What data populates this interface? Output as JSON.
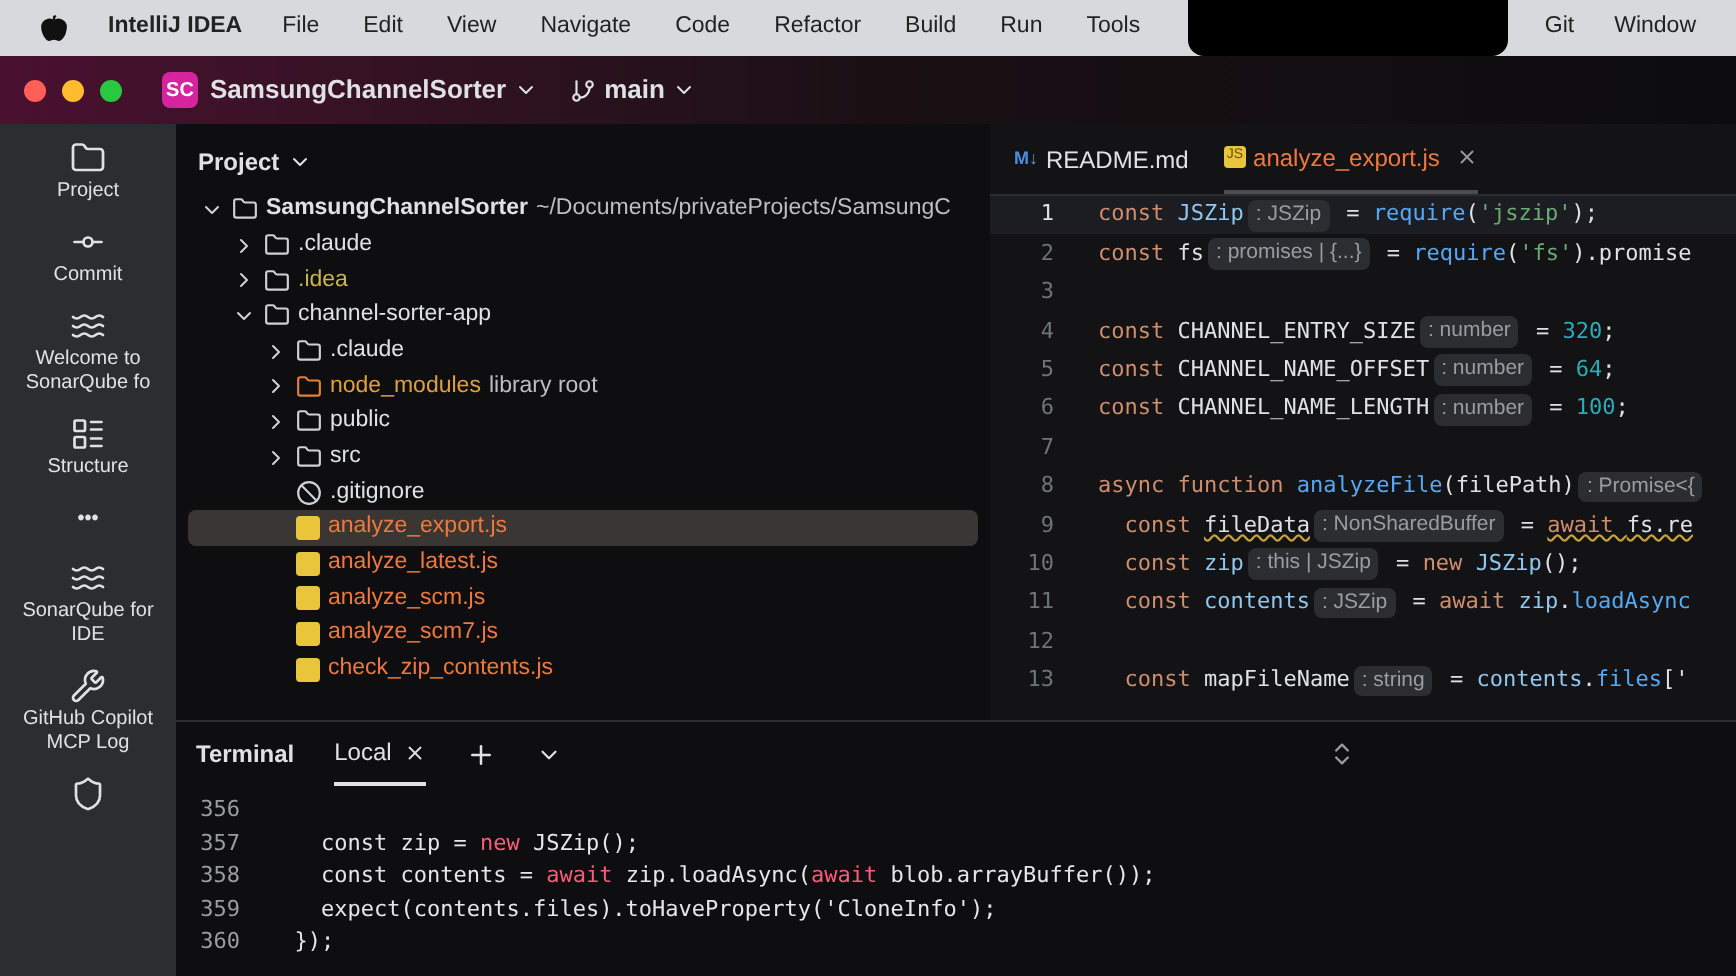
{
  "menu_bar": {
    "app": "IntelliJ IDEA",
    "items": [
      "File",
      "Edit",
      "View",
      "Navigate",
      "Code",
      "Refactor",
      "Build",
      "Run",
      "Tools"
    ],
    "right_items": [
      "Git",
      "Window"
    ]
  },
  "title_bar": {
    "project_badge": "SC",
    "project": "SamsungChannelSorter",
    "branch": "main"
  },
  "tool_strip": [
    {
      "kind": "folder",
      "label": "Project"
    },
    {
      "kind": "commit",
      "label": "Commit"
    },
    {
      "kind": "sonar",
      "label": "Welcome to SonarQube fo"
    },
    {
      "kind": "structure",
      "label": "Structure"
    },
    {
      "kind": "more",
      "label": "•••"
    },
    {
      "kind": "sonar",
      "label": "SonarQube for IDE"
    },
    {
      "kind": "wrench",
      "label": "GitHub Copilot MCP Log"
    },
    {
      "kind": "shield"
    }
  ],
  "project_panel": {
    "title": "Project",
    "tree": [
      {
        "kind": "root",
        "name": "SamsungChannelSorter",
        "note": "~/Documents/privateProjects/SamsungC",
        "ignored": false,
        "unversioned": false,
        "expanded": true,
        "selected": false,
        "children": [
          {
            "kind": "folder",
            "name": ".claude",
            "ignored": false,
            "unversioned": false,
            "expanded": false,
            "selected": false
          },
          {
            "kind": "folder",
            "name": ".idea",
            "ignored": true,
            "unversioned": false,
            "expanded": false,
            "selected": false
          },
          {
            "kind": "folder",
            "name": "channel-sorter-app",
            "ignored": false,
            "unversioned": false,
            "expanded": true,
            "selected": false,
            "children": [
              {
                "kind": "folder",
                "name": ".claude",
                "ignored": false,
                "unversioned": false,
                "expanded": false,
                "selected": false
              },
              {
                "kind": "library",
                "name": "node_modules",
                "note": "library root",
                "ignored": false,
                "unversioned": false,
                "expanded": false,
                "selected": false
              },
              {
                "kind": "folder",
                "name": "public",
                "ignored": false,
                "unversioned": false,
                "expanded": false,
                "selected": false
              },
              {
                "kind": "folder",
                "name": "src",
                "ignored": false,
                "unversioned": false,
                "expanded": false,
                "selected": false
              },
              {
                "kind": "ignore",
                "name": ".gitignore",
                "ignored": false,
                "unversioned": false,
                "selected": false
              },
              {
                "kind": "js",
                "name": "analyze_export.js",
                "unversioned": true,
                "selected": true
              },
              {
                "kind": "js",
                "name": "analyze_latest.js",
                "unversioned": true,
                "selected": false
              },
              {
                "kind": "js",
                "name": "analyze_scm.js",
                "unversioned": true,
                "selected": false
              },
              {
                "kind": "js",
                "name": "analyze_scm7.js",
                "unversioned": true,
                "selected": false
              },
              {
                "kind": "js",
                "name": "check_zip_contents.js",
                "unversioned": true,
                "selected": false
              }
            ]
          }
        ]
      }
    ]
  },
  "editor": {
    "tabs": [
      {
        "kind": "md",
        "badge": "M↓",
        "label": "README.md",
        "selected": false
      },
      {
        "kind": "js",
        "badge": "JS",
        "label": "analyze_export.js",
        "selected": true
      }
    ],
    "lines": [
      {
        "number": "1",
        "current": true,
        "tokens": [
          {
            "kind": "kw",
            "text": "const "
          },
          {
            "kind": "local",
            "text": "JSZip"
          },
          {
            "kind": "hint",
            "text": ": JSZip"
          },
          {
            "kind": "plain",
            "text": " = "
          },
          {
            "kind": "fn",
            "text": "require"
          },
          {
            "kind": "plain",
            "text": "("
          },
          {
            "kind": "str",
            "text": "'jszip'"
          },
          {
            "kind": "plain",
            "text": ");"
          }
        ]
      },
      {
        "number": "2",
        "current": false,
        "tokens": [
          {
            "kind": "kw",
            "text": "const "
          },
          {
            "kind": "plain",
            "text": "fs"
          },
          {
            "kind": "hint",
            "text": ": promises | {...}"
          },
          {
            "kind": "plain",
            "text": " = "
          },
          {
            "kind": "fn",
            "text": "require"
          },
          {
            "kind": "plain",
            "text": "("
          },
          {
            "kind": "str",
            "text": "'fs'"
          },
          {
            "kind": "plain",
            "text": ").promise"
          }
        ]
      },
      {
        "number": "3",
        "current": false
      },
      {
        "number": "4",
        "current": false,
        "tokens": [
          {
            "kind": "kw",
            "text": "const "
          },
          {
            "kind": "plain",
            "text": "CHANNEL_ENTRY_SIZE"
          },
          {
            "kind": "hint",
            "text": ": number"
          },
          {
            "kind": "plain",
            "text": " = "
          },
          {
            "kind": "num",
            "text": "320"
          },
          {
            "kind": "plain",
            "text": ";"
          }
        ]
      },
      {
        "number": "5",
        "current": false,
        "tokens": [
          {
            "kind": "kw",
            "text": "const "
          },
          {
            "kind": "plain",
            "text": "CHANNEL_NAME_OFFSET"
          },
          {
            "kind": "hint",
            "text": ": number"
          },
          {
            "kind": "plain",
            "text": " = "
          },
          {
            "kind": "num",
            "text": "64"
          },
          {
            "kind": "plain",
            "text": ";"
          }
        ]
      },
      {
        "number": "6",
        "current": false,
        "tokens": [
          {
            "kind": "kw",
            "text": "const "
          },
          {
            "kind": "plain",
            "text": "CHANNEL_NAME_LENGTH"
          },
          {
            "kind": "hint",
            "text": ": number"
          },
          {
            "kind": "plain",
            "text": " = "
          },
          {
            "kind": "num",
            "text": "100"
          },
          {
            "kind": "plain",
            "text": ";"
          }
        ]
      },
      {
        "number": "7",
        "current": false
      },
      {
        "number": "8",
        "current": false,
        "tokens": [
          {
            "kind": "kw",
            "text": "async function "
          },
          {
            "kind": "fn",
            "text": "analyzeFile"
          },
          {
            "kind": "plain",
            "text": "(filePath)"
          },
          {
            "kind": "hint",
            "text": ": Promise<{"
          }
        ]
      },
      {
        "number": "9",
        "current": false,
        "tokens": [
          {
            "kind": "kw",
            "text": "  const "
          },
          {
            "kind": "plain",
            "text": "fileData",
            "warning": true
          },
          {
            "kind": "hint",
            "text": ": NonSharedBuffer"
          },
          {
            "kind": "plain",
            "text": " = "
          },
          {
            "kind": "kw",
            "text": "await ",
            "warning": true
          },
          {
            "kind": "plain",
            "text": "fs.re",
            "warning": true
          }
        ]
      },
      {
        "number": "10",
        "current": false,
        "tokens": [
          {
            "kind": "kw",
            "text": "  const "
          },
          {
            "kind": "local",
            "text": "zip"
          },
          {
            "kind": "hint",
            "text": ": this | JSZip"
          },
          {
            "kind": "plain",
            "text": " = "
          },
          {
            "kind": "kw",
            "text": "new "
          },
          {
            "kind": "local",
            "text": "JSZip"
          },
          {
            "kind": "plain",
            "text": "();"
          }
        ]
      },
      {
        "number": "11",
        "current": false,
        "tokens": [
          {
            "kind": "kw",
            "text": "  const "
          },
          {
            "kind": "local",
            "text": "contents"
          },
          {
            "kind": "hint",
            "text": ": JSZip"
          },
          {
            "kind": "plain",
            "text": " = "
          },
          {
            "kind": "kw",
            "text": "await "
          },
          {
            "kind": "local",
            "text": "zip"
          },
          {
            "kind": "plain",
            "text": "."
          },
          {
            "kind": "fn",
            "text": "loadAsync"
          }
        ]
      },
      {
        "number": "12",
        "current": false
      },
      {
        "number": "13",
        "current": false,
        "tokens": [
          {
            "kind": "kw",
            "text": "  const "
          },
          {
            "kind": "plain",
            "text": "mapFileName"
          },
          {
            "kind": "hint",
            "text": ": string"
          },
          {
            "kind": "plain",
            "text": " = "
          },
          {
            "kind": "local",
            "text": "contents"
          },
          {
            "kind": "plain",
            "text": "."
          },
          {
            "kind": "fn",
            "text": "files"
          },
          {
            "kind": "plain",
            "text": "['"
          }
        ]
      }
    ]
  },
  "terminal": {
    "title": "Terminal",
    "tabs": [
      {
        "label": "Local",
        "selected": true
      }
    ],
    "lines": [
      {
        "number": "356"
      },
      {
        "number": "357",
        "tokens": [
          {
            "kind": "plain",
            "text": "    const zip = "
          },
          {
            "kind": "kw",
            "text": "new"
          },
          {
            "kind": "plain",
            "text": " JSZip();"
          }
        ]
      },
      {
        "number": "358",
        "tokens": [
          {
            "kind": "plain",
            "text": "    const contents = "
          },
          {
            "kind": "kw",
            "text": "await"
          },
          {
            "kind": "plain",
            "text": " zip.loadAsync("
          },
          {
            "kind": "kw",
            "text": "await"
          },
          {
            "kind": "plain",
            "text": " blob.arrayBuffer());"
          }
        ]
      },
      {
        "number": "359",
        "tokens": [
          {
            "kind": "plain",
            "text": "    expect(contents.files).toHaveProperty('CloneInfo');"
          }
        ]
      },
      {
        "number": "360",
        "tokens": [
          {
            "kind": "plain",
            "text": "  });"
          }
        ]
      }
    ]
  }
}
